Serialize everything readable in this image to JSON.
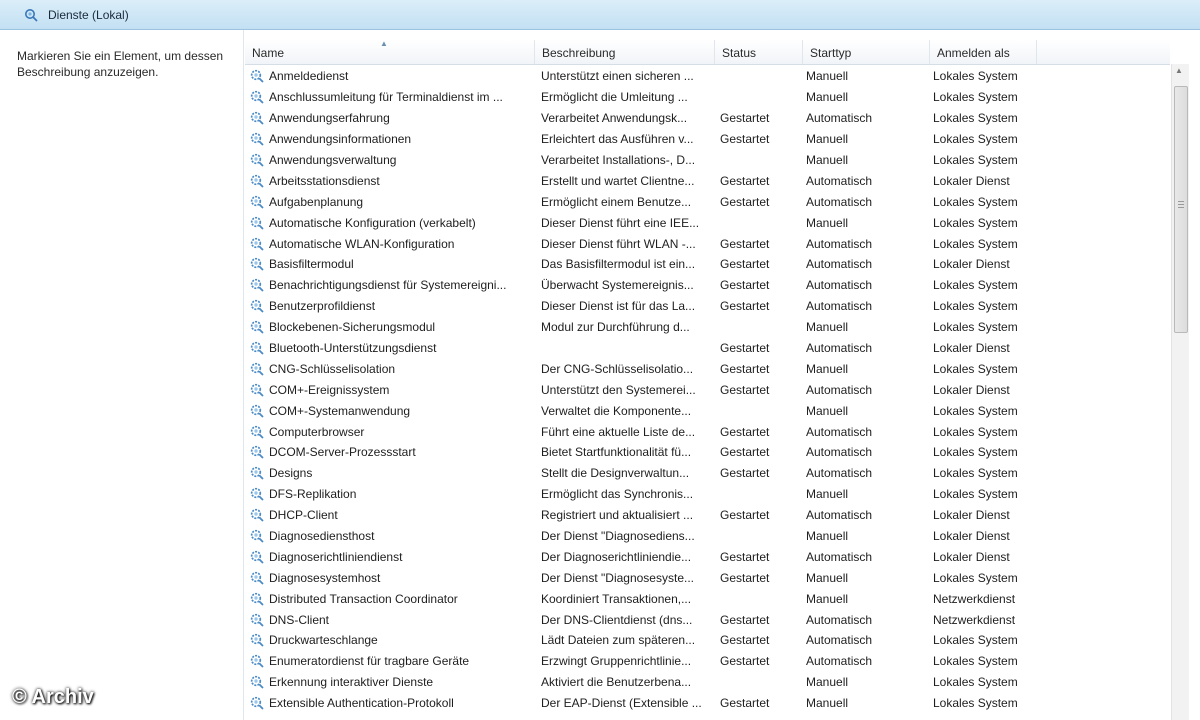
{
  "window": {
    "title": "Dienste (Lokal)",
    "icon": "gear-magnifier-icon",
    "accent": "#c3e0f3"
  },
  "left_pane": {
    "description": "Markieren Sie ein Element, um dessen Beschreibung anzuzeigen."
  },
  "table": {
    "columns": {
      "name": "Name",
      "description": "Beschreibung",
      "status": "Status",
      "starttype": "Starttyp",
      "logon": "Anmelden als"
    },
    "rows": [
      {
        "name": "Anmeldedienst",
        "description": "Unterstützt einen sicheren ...",
        "status": "",
        "starttype": "Manuell",
        "logon": "Lokales System"
      },
      {
        "name": "Anschlussumleitung für Terminaldienst im ...",
        "description": "Ermöglicht die Umleitung ...",
        "status": "",
        "starttype": "Manuell",
        "logon": "Lokales System"
      },
      {
        "name": "Anwendungserfahrung",
        "description": "Verarbeitet Anwendungsk...",
        "status": "Gestartet",
        "starttype": "Automatisch",
        "logon": "Lokales System"
      },
      {
        "name": "Anwendungsinformationen",
        "description": "Erleichtert das Ausführen v...",
        "status": "Gestartet",
        "starttype": "Manuell",
        "logon": "Lokales System"
      },
      {
        "name": "Anwendungsverwaltung",
        "description": "Verarbeitet Installations-, D...",
        "status": "",
        "starttype": "Manuell",
        "logon": "Lokales System"
      },
      {
        "name": "Arbeitsstationsdienst",
        "description": "Erstellt und wartet Clientne...",
        "status": "Gestartet",
        "starttype": "Automatisch",
        "logon": "Lokaler Dienst"
      },
      {
        "name": "Aufgabenplanung",
        "description": "Ermöglicht einem Benutze...",
        "status": "Gestartet",
        "starttype": "Automatisch",
        "logon": "Lokales System"
      },
      {
        "name": "Automatische Konfiguration (verkabelt)",
        "description": "Dieser Dienst führt eine IEE...",
        "status": "",
        "starttype": "Manuell",
        "logon": "Lokales System"
      },
      {
        "name": "Automatische WLAN-Konfiguration",
        "description": "Dieser Dienst führt WLAN -...",
        "status": "Gestartet",
        "starttype": "Automatisch",
        "logon": "Lokales System"
      },
      {
        "name": "Basisfiltermodul",
        "description": "Das Basisfiltermodul ist ein...",
        "status": "Gestartet",
        "starttype": "Automatisch",
        "logon": "Lokaler Dienst"
      },
      {
        "name": "Benachrichtigungsdienst für Systemereigni...",
        "description": "Überwacht Systemereignis...",
        "status": "Gestartet",
        "starttype": "Automatisch",
        "logon": "Lokales System"
      },
      {
        "name": "Benutzerprofildienst",
        "description": "Dieser Dienst ist für das La...",
        "status": "Gestartet",
        "starttype": "Automatisch",
        "logon": "Lokales System"
      },
      {
        "name": "Blockebenen-Sicherungsmodul",
        "description": "Modul zur Durchführung d...",
        "status": "",
        "starttype": "Manuell",
        "logon": "Lokales System"
      },
      {
        "name": "Bluetooth-Unterstützungsdienst",
        "description": "",
        "status": "Gestartet",
        "starttype": "Automatisch",
        "logon": "Lokaler Dienst"
      },
      {
        "name": "CNG-Schlüsselisolation",
        "description": "Der CNG-Schlüsselisolatio...",
        "status": "Gestartet",
        "starttype": "Manuell",
        "logon": "Lokales System"
      },
      {
        "name": "COM+-Ereignissystem",
        "description": "Unterstützt den Systemerei...",
        "status": "Gestartet",
        "starttype": "Automatisch",
        "logon": "Lokaler Dienst"
      },
      {
        "name": "COM+-Systemanwendung",
        "description": "Verwaltet die Komponente...",
        "status": "",
        "starttype": "Manuell",
        "logon": "Lokales System"
      },
      {
        "name": "Computerbrowser",
        "description": "Führt eine aktuelle Liste de...",
        "status": "Gestartet",
        "starttype": "Automatisch",
        "logon": "Lokales System"
      },
      {
        "name": "DCOM-Server-Prozessstart",
        "description": "Bietet Startfunktionalität fü...",
        "status": "Gestartet",
        "starttype": "Automatisch",
        "logon": "Lokales System"
      },
      {
        "name": "Designs",
        "description": "Stellt die Designverwaltun...",
        "status": "Gestartet",
        "starttype": "Automatisch",
        "logon": "Lokales System"
      },
      {
        "name": "DFS-Replikation",
        "description": "Ermöglicht das Synchronis...",
        "status": "",
        "starttype": "Manuell",
        "logon": "Lokales System"
      },
      {
        "name": "DHCP-Client",
        "description": "Registriert und aktualisiert ...",
        "status": "Gestartet",
        "starttype": "Automatisch",
        "logon": "Lokaler Dienst"
      },
      {
        "name": "Diagnosediensthost",
        "description": "Der Dienst \"Diagnosediens...",
        "status": "",
        "starttype": "Manuell",
        "logon": "Lokaler Dienst"
      },
      {
        "name": "Diagnoserichtliniendienst",
        "description": "Der Diagnoserichtliniendie...",
        "status": "Gestartet",
        "starttype": "Automatisch",
        "logon": "Lokaler Dienst"
      },
      {
        "name": "Diagnosesystemhost",
        "description": "Der Dienst \"Diagnosesyste...",
        "status": "Gestartet",
        "starttype": "Manuell",
        "logon": "Lokales System"
      },
      {
        "name": "Distributed Transaction Coordinator",
        "description": "Koordiniert Transaktionen,...",
        "status": "",
        "starttype": "Manuell",
        "logon": "Netzwerkdienst"
      },
      {
        "name": "DNS-Client",
        "description": "Der DNS-Clientdienst (dns...",
        "status": "Gestartet",
        "starttype": "Automatisch",
        "logon": "Netzwerkdienst"
      },
      {
        "name": "Druckwarteschlange",
        "description": "Lädt Dateien zum späteren...",
        "status": "Gestartet",
        "starttype": "Automatisch",
        "logon": "Lokales System"
      },
      {
        "name": "Enumeratordienst für tragbare Geräte",
        "description": "Erzwingt Gruppenrichtlinie...",
        "status": "Gestartet",
        "starttype": "Automatisch",
        "logon": "Lokales System"
      },
      {
        "name": "Erkennung interaktiver Dienste",
        "description": "Aktiviert die Benutzerbena...",
        "status": "",
        "starttype": "Manuell",
        "logon": "Lokales System"
      },
      {
        "name": "Extensible Authentication-Protokoll",
        "description": "Der EAP-Dienst (Extensible ...",
        "status": "Gestartet",
        "starttype": "Manuell",
        "logon": "Lokales System"
      }
    ],
    "row_icon": "service-gear-icon"
  },
  "watermark": "© Archiv"
}
